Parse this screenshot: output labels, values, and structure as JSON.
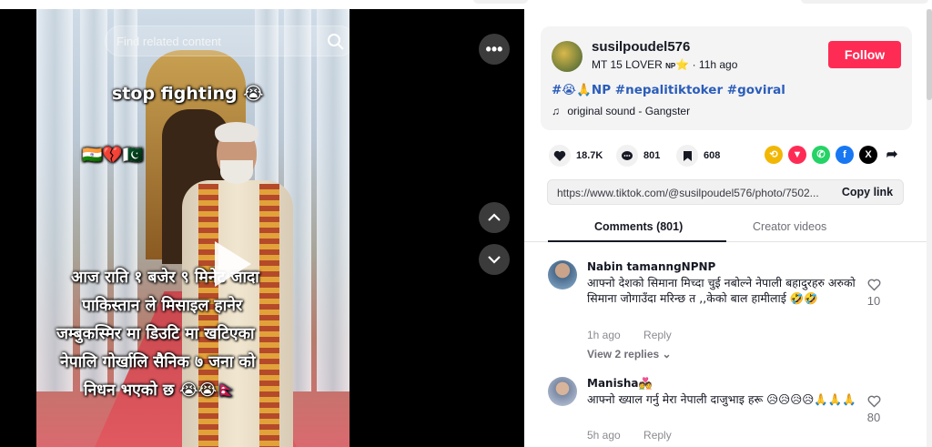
{
  "video": {
    "search_placeholder": "Find related content",
    "caption_title": "stop fighting 😭",
    "caption_flags": "🇮🇳💔🇵🇰",
    "caption_lines": [
      "आज राति १ बजेर ९ मिनेट जादा",
      "पाकिस्तान ले मिसाइल हानेर",
      "जम्बुकस्मिर मा डिउटि मा खटिएका",
      "नेपालि गोर्खालि सैनिक ७ जना को",
      "निधन भएको छ 😭😭🇳🇵"
    ],
    "more_label": "•••"
  },
  "author": {
    "username": "susilpoudel576",
    "nickname": "MT 15 LOVER",
    "badge": "NP",
    "star": "⭐",
    "time": "11h ago",
    "separator": "·",
    "follow_label": "Follow",
    "hashtags": "#😭🙏NP #nepalitiktoker #goviral",
    "sound": "original sound - Gangster"
  },
  "actions": {
    "likes": "18.7K",
    "comments": "801",
    "saves": "608",
    "share_colors": [
      "#f2b705",
      "#fe2c55",
      "#25d366",
      "#1877f2",
      "#000000"
    ]
  },
  "link": {
    "url": "https://www.tiktok.com/@susilpoudel576/photo/7502...",
    "copy_label": "Copy link"
  },
  "tabs": {
    "comments": "Comments (801)",
    "creator": "Creator videos"
  },
  "comments": [
    {
      "name": "Nabin tamanngNPNP",
      "text": "आफ्नो देशको सिमाना मिच्दा चुई नबोल्ने नेपाली बहादुरहरु अरुको सिमाना जोगाउँदा मरिन्छ त ,,केको बाल हामीलाई 🤣🤣",
      "time": "1h ago",
      "reply": "Reply",
      "likes": "10",
      "view_replies": "View 2 replies ⌄"
    },
    {
      "name": "Manisha💑",
      "text": "आफ्नो ख्याल गर्नु मेरा नेपाली दाजुभाइ हरू 😥😥😥😥🙏🙏🙏",
      "time": "5h ago",
      "reply": "Reply",
      "likes": "80"
    }
  ]
}
